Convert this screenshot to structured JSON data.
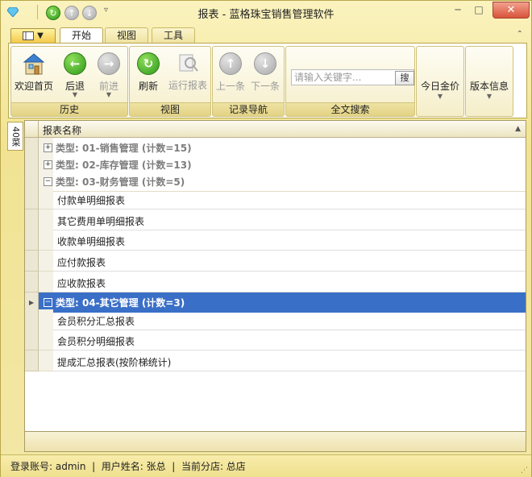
{
  "window": {
    "title": "报表 - 蓝格珠宝销售管理软件",
    "close_glyph": "✕",
    "maximize_glyph": "□",
    "minimize_glyph": "─"
  },
  "quick_access": [
    "refresh-icon",
    "up-arrow-icon",
    "down-arrow-icon",
    "customize-dropdown-icon"
  ],
  "tabs": [
    {
      "label": "开始",
      "active": true
    },
    {
      "label": "视图",
      "active": false
    },
    {
      "label": "工具",
      "active": false
    }
  ],
  "ribbon": {
    "history": {
      "label": "历史",
      "buttons": [
        {
          "label": "欢迎首页",
          "icon": "home-icon",
          "enabled": true
        },
        {
          "label": "后退",
          "icon": "back-icon",
          "enabled": true,
          "dropdown": true
        },
        {
          "label": "前进",
          "icon": "forward-icon",
          "enabled": false,
          "dropdown": true
        }
      ]
    },
    "view": {
      "label": "视图",
      "buttons": [
        {
          "label": "刷新",
          "icon": "refresh-icon",
          "enabled": true
        },
        {
          "label": "运行报表",
          "icon": "run-report-icon",
          "enabled": false
        }
      ]
    },
    "nav": {
      "label": "记录导航",
      "buttons": [
        {
          "label": "上一条",
          "icon": "up-icon",
          "enabled": false
        },
        {
          "label": "下一条",
          "icon": "down-icon",
          "enabled": false
        }
      ]
    },
    "search": {
      "label": "全文搜索",
      "placeholder": "请输入关键字...",
      "button": "搜"
    },
    "today_gold": {
      "label": "今日金价"
    },
    "version": {
      "label": "版本信息"
    }
  },
  "side_tab": {
    "label": "40菜"
  },
  "grid": {
    "column": "报表名称",
    "rows": [
      {
        "type": "group",
        "label": "类型: 01-销售管理 (计数=15)",
        "expanded": false,
        "selected": false
      },
      {
        "type": "group",
        "label": "类型: 02-库存管理 (计数=13)",
        "expanded": false,
        "selected": false
      },
      {
        "type": "group",
        "label": "类型: 03-财务管理 (计数=5)",
        "expanded": true,
        "selected": false
      },
      {
        "type": "item",
        "label": "付款单明细报表"
      },
      {
        "type": "item",
        "label": "其它费用单明细报表"
      },
      {
        "type": "item",
        "label": "收款单明细报表"
      },
      {
        "type": "item",
        "label": "应付款报表"
      },
      {
        "type": "item",
        "label": "应收款报表"
      },
      {
        "type": "group",
        "label": "类型: 04-其它管理 (计数=3)",
        "expanded": true,
        "selected": true
      },
      {
        "type": "item",
        "label": "会员积分汇总报表"
      },
      {
        "type": "item",
        "label": "会员积分明细报表"
      },
      {
        "type": "item",
        "label": "提成汇总报表(按阶梯统计)"
      }
    ]
  },
  "status": {
    "account": "登录账号: admin",
    "user": "用户姓名: 张总",
    "store": "当前分店: 总店"
  }
}
